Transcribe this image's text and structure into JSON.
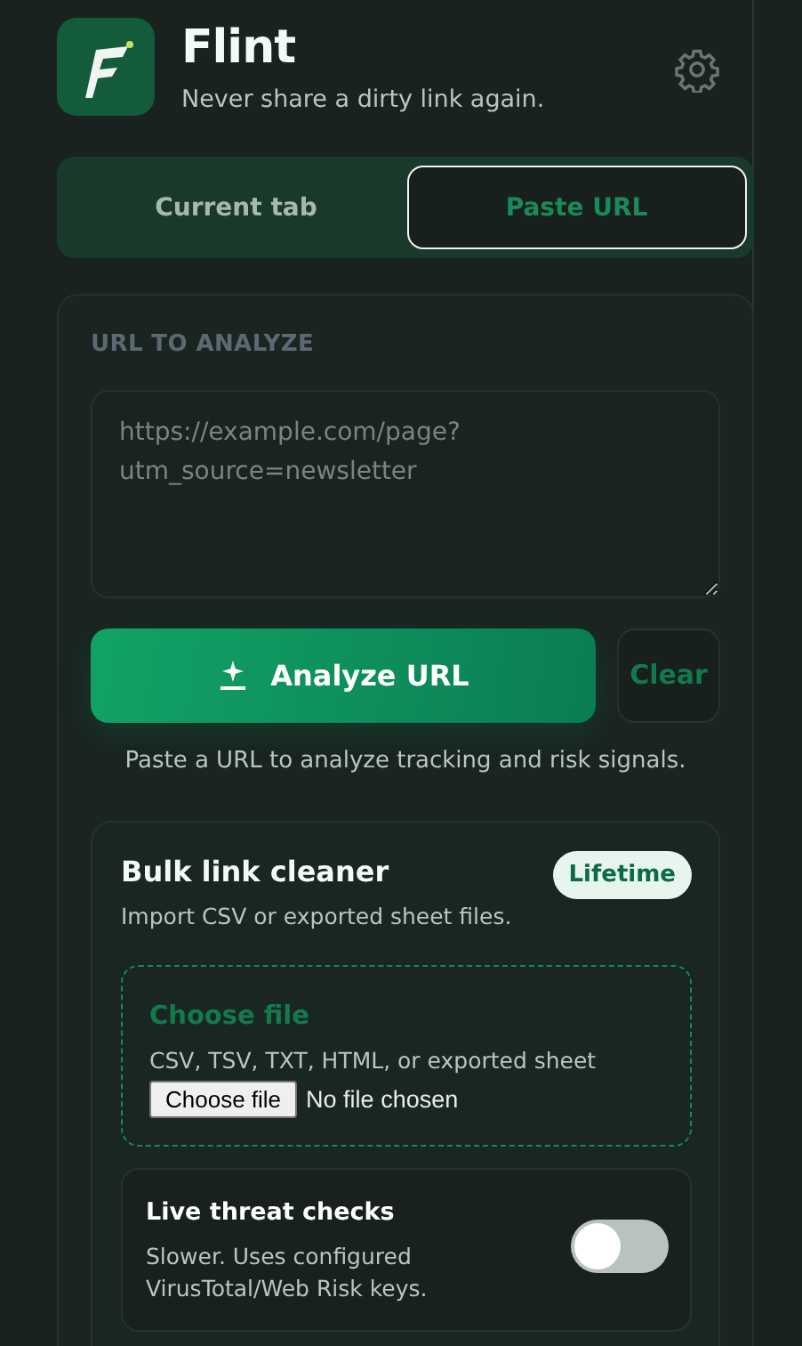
{
  "header": {
    "title": "Flint",
    "tagline": "Never share a dirty link again."
  },
  "tabs": [
    {
      "label": "Current tab",
      "selected": false
    },
    {
      "label": "Paste URL",
      "selected": true
    }
  ],
  "analyze": {
    "section_label": "URL TO ANALYZE",
    "url_field": {
      "placeholder": "https://example.com/page?utm_source=newsletter"
    },
    "analyze_button": "Analyze URL",
    "clear_button": "Clear",
    "hint": "Paste a URL to analyze tracking and risk signals."
  },
  "bulk": {
    "title": "Bulk link cleaner",
    "badge": "Lifetime",
    "subtitle": "Import CSV or exported sheet files.",
    "dropzone": {
      "title": "Choose file",
      "formats": "CSV, TSV, TXT, HTML, or exported sheet",
      "file_button": "Choose file",
      "file_status": "No file chosen"
    },
    "threat_check": {
      "title": "Live threat checks",
      "description": "Slower. Uses configured VirusTotal/Web Risk keys.",
      "on": false
    }
  }
}
